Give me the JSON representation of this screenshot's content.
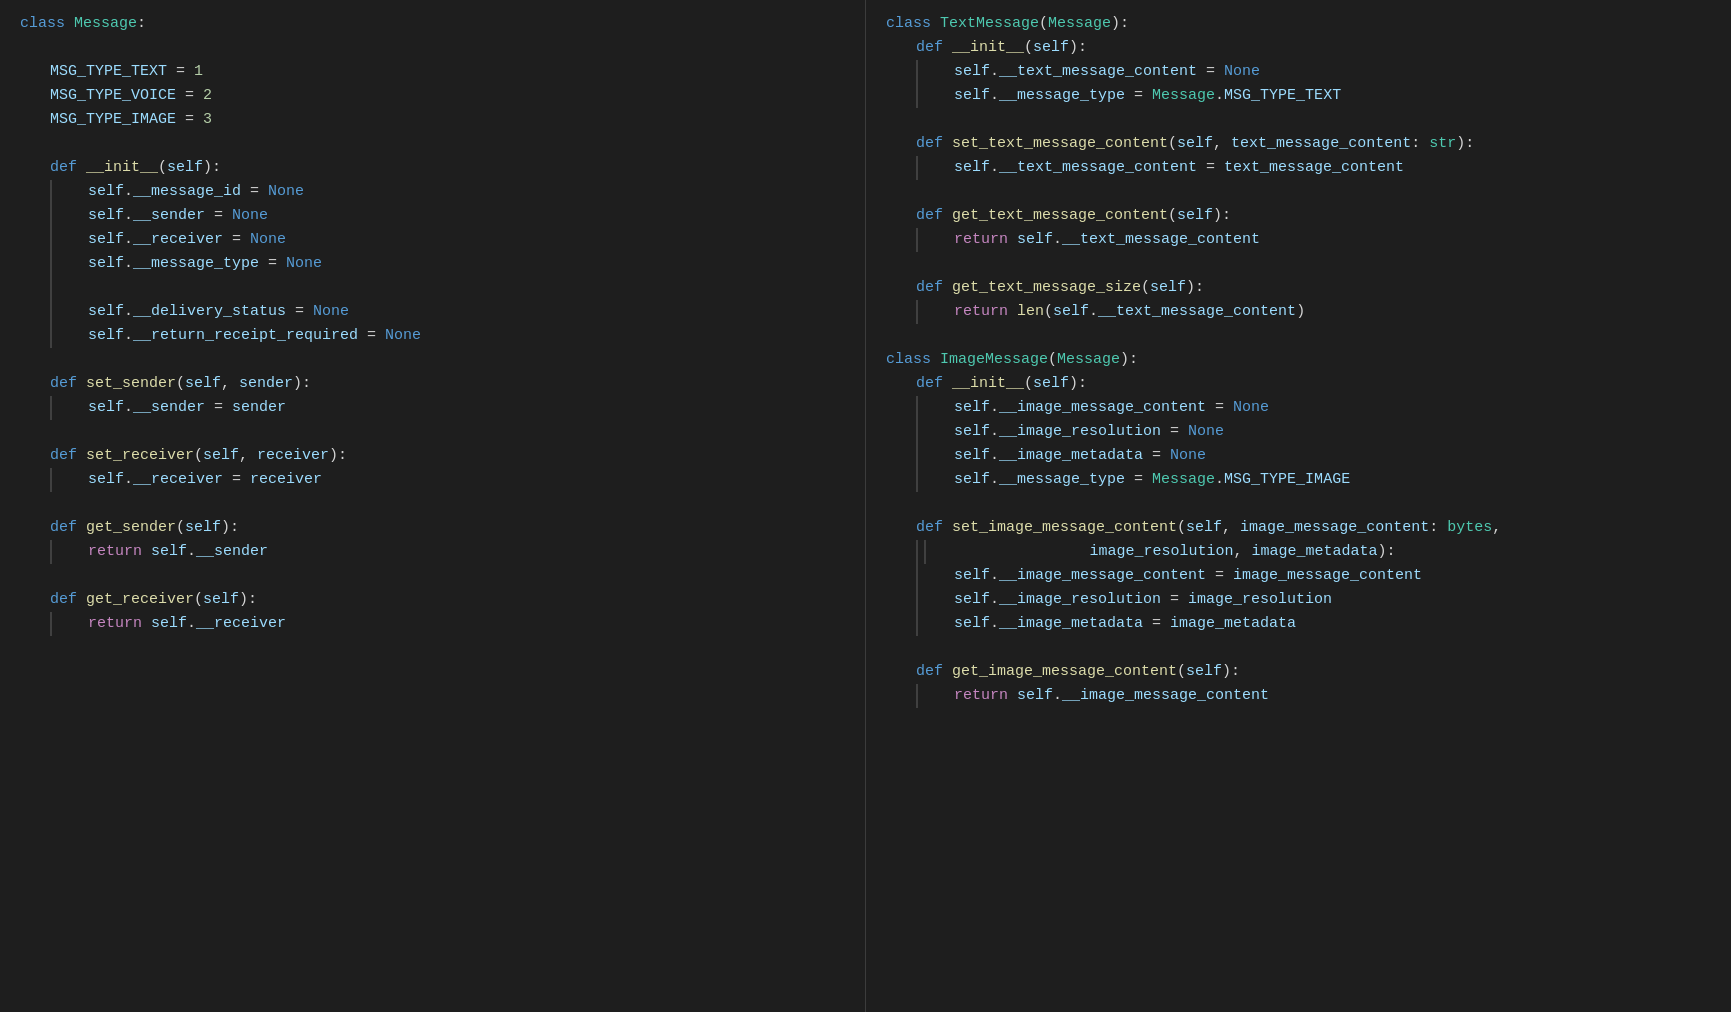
{
  "left_pane": {
    "lines": [
      {
        "type": "class_def",
        "text": "class Message:"
      },
      {
        "type": "blank"
      },
      {
        "type": "attr_assign_1",
        "text": "    MSG_TYPE_TEXT = 1"
      },
      {
        "type": "attr_assign_1",
        "text": "    MSG_TYPE_VOICE = 2"
      },
      {
        "type": "attr_assign_1",
        "text": "    MSG_TYPE_IMAGE = 3"
      },
      {
        "type": "blank"
      },
      {
        "type": "def_1",
        "text": "    def __init__(self):"
      },
      {
        "type": "self_assign_bar",
        "text": "        self.__message_id = None"
      },
      {
        "type": "self_assign_bar",
        "text": "        self.__sender = None"
      },
      {
        "type": "self_assign_bar",
        "text": "        self.__receiver = None"
      },
      {
        "type": "self_assign_bar",
        "text": "        self.__message_type = None"
      },
      {
        "type": "blank_bar"
      },
      {
        "type": "self_assign_bar",
        "text": "        self.__delivery_status = None"
      },
      {
        "type": "self_assign_bar",
        "text": "        self.__return_receipt_required = None"
      },
      {
        "type": "blank"
      },
      {
        "type": "def_1",
        "text": "    def set_sender(self, sender):"
      },
      {
        "type": "self_assign_bar2",
        "text": "        self.__sender = sender"
      },
      {
        "type": "blank"
      },
      {
        "type": "def_1",
        "text": "    def set_receiver(self, receiver):"
      },
      {
        "type": "self_assign_bar2",
        "text": "        self.__receiver = receiver"
      },
      {
        "type": "blank"
      },
      {
        "type": "def_1",
        "text": "    def get_sender(self):"
      },
      {
        "type": "return_bar",
        "text": "        return self.__sender"
      },
      {
        "type": "blank"
      },
      {
        "type": "def_1",
        "text": "    def get_receiver(self):"
      },
      {
        "type": "return_bar",
        "text": "        return self.__receiver"
      }
    ]
  },
  "right_pane": {
    "lines": [
      {
        "type": "class_def",
        "text": "class TextMessage(Message):"
      },
      {
        "type": "def_1",
        "text": "    def __init__(self):"
      },
      {
        "type": "self_assign_bar",
        "text": "        self.__text_message_content = None"
      },
      {
        "type": "self_assign_bar",
        "text": "        self.__message_type = Message.MSG_TYPE_TEXT"
      },
      {
        "type": "blank"
      },
      {
        "type": "def_1",
        "text": "    def set_text_message_content(self, text_message_content: str):"
      },
      {
        "type": "self_assign_bar2",
        "text": "        self.__text_message_content = text_message_content"
      },
      {
        "type": "blank"
      },
      {
        "type": "def_1",
        "text": "    def get_text_message_content(self):"
      },
      {
        "type": "return_bar",
        "text": "        return self.__text_message_content"
      },
      {
        "type": "blank"
      },
      {
        "type": "def_1",
        "text": "    def get_text_message_size(self):"
      },
      {
        "type": "return_bar",
        "text": "        return len(self.__text_message_content)"
      },
      {
        "type": "blank"
      },
      {
        "type": "class_def",
        "text": "class ImageMessage(Message):"
      },
      {
        "type": "def_1",
        "text": "    def __init__(self):"
      },
      {
        "type": "self_assign_bar",
        "text": "        self.__image_message_content = None"
      },
      {
        "type": "self_assign_bar",
        "text": "        self.__image_resolution = None"
      },
      {
        "type": "self_assign_bar",
        "text": "        self.__image_metadata = None"
      },
      {
        "type": "self_assign_bar",
        "text": "        self.__message_type = Message.MSG_TYPE_IMAGE"
      },
      {
        "type": "blank"
      },
      {
        "type": "def_1",
        "text": "    def set_image_message_content(self, image_message_content: bytes,"
      },
      {
        "type": "continuation_bar",
        "text": "                                   image_resolution, image_metadata):"
      },
      {
        "type": "self_assign_bar2",
        "text": "        self.__image_message_content = image_message_content"
      },
      {
        "type": "self_assign_bar2",
        "text": "        self.__image_resolution = image_resolution"
      },
      {
        "type": "self_assign_bar2",
        "text": "        self.__image_metadata = image_metadata"
      },
      {
        "type": "blank"
      },
      {
        "type": "def_1",
        "text": "    def get_image_message_content(self):"
      },
      {
        "type": "return_bar",
        "text": "        return self.__image_message_content"
      }
    ]
  }
}
